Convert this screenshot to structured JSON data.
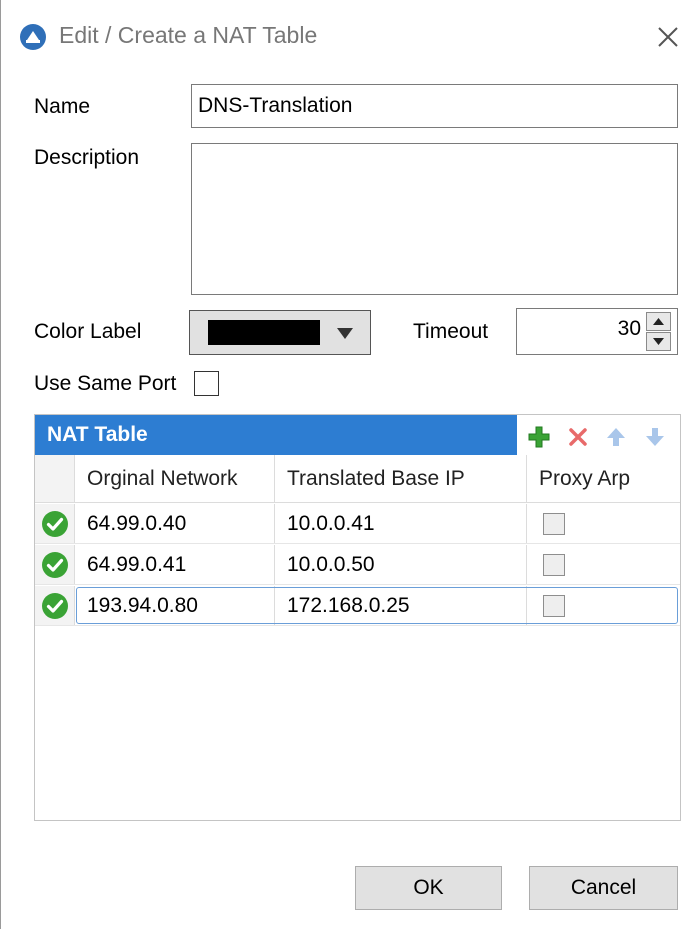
{
  "window": {
    "title": "Edit / Create a NAT Table"
  },
  "form": {
    "name_label": "Name",
    "name_value": "DNS-Translation",
    "description_label": "Description",
    "description_value": "",
    "color_label": "Color Label",
    "color_value": "#000000",
    "timeout_label": "Timeout",
    "timeout_value": "30",
    "use_same_port_label": "Use Same Port",
    "use_same_port_checked": false
  },
  "nat_table": {
    "title": "NAT Table",
    "columns": [
      "Orginal Network",
      "Translated Base IP",
      "Proxy Arp"
    ],
    "rows": [
      {
        "original": "64.99.0.40",
        "translated": "10.0.0.41",
        "proxy_arp": false
      },
      {
        "original": "64.99.0.41",
        "translated": "10.0.0.50",
        "proxy_arp": false
      },
      {
        "original": "193.94.0.80",
        "translated": "172.168.0.25",
        "proxy_arp": false
      }
    ],
    "toolbar_icons": [
      "add-icon",
      "delete-icon",
      "move-up-icon",
      "move-down-icon"
    ]
  },
  "buttons": {
    "ok": "OK",
    "cancel": "Cancel"
  },
  "colors": {
    "header_blue": "#2d7dd2",
    "status_green": "#3aa335"
  }
}
